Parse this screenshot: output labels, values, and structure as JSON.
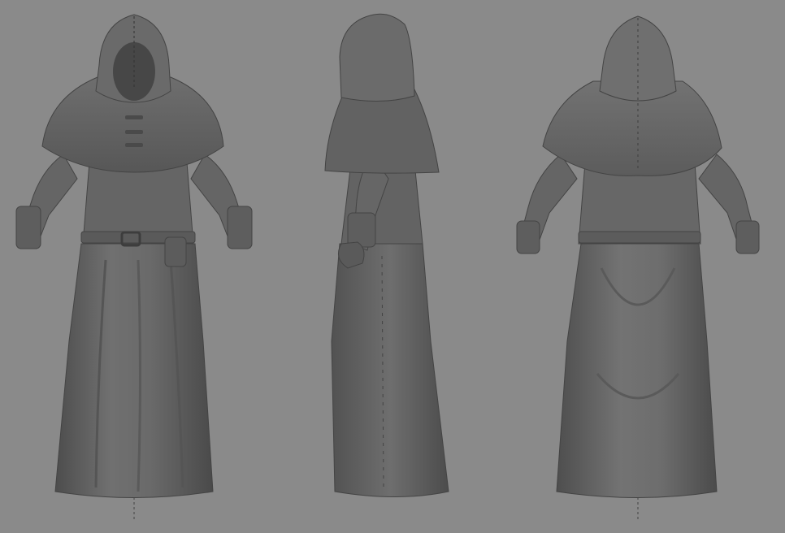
{
  "scene": {
    "background_color": "#8a8a8a",
    "model_base_color": "#6a6a6a",
    "model_shadow_color": "#4e4e4e",
    "model_highlight_color": "#8c8c8c",
    "views": [
      {
        "name": "front"
      },
      {
        "name": "side"
      },
      {
        "name": "back"
      }
    ]
  }
}
